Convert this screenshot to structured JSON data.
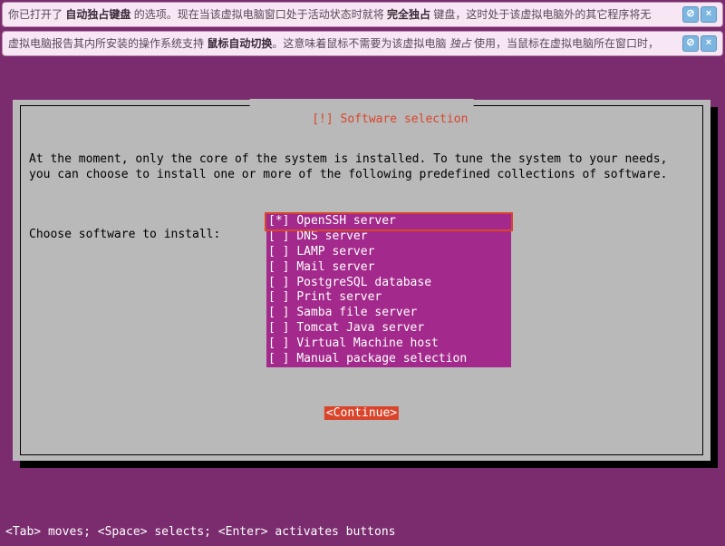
{
  "notifs": [
    {
      "prefix": "你已打开了 ",
      "bold1": "自动独占键盘",
      "mid": " 的选项。现在当该虚拟电脑窗口处于活动状态时就将 ",
      "bold2": "完全独占",
      "suffix": " 键盘，这时处于该虚拟电脑外的其它程序将无"
    },
    {
      "prefix": "虚拟电脑报告其内所安装的操作系统支持 ",
      "bold1": "鼠标自动切换",
      "mid": "。这意味着鼠标不需要为该虚拟电脑 ",
      "italic": "独占",
      "suffix": " 使用，当鼠标在虚拟电脑所在窗口时，"
    }
  ],
  "panel": {
    "title": "[!] Software selection",
    "desc": "At the moment, only the core of the system is installed. To tune the system to your needs, you can choose to install one or more of the following predefined collections of software.",
    "prompt": "Choose software to install:",
    "items": [
      {
        "mark": "[*]",
        "label": "OpenSSH server",
        "selected": true
      },
      {
        "mark": "[ ]",
        "label": "DNS server"
      },
      {
        "mark": "[ ]",
        "label": "LAMP server"
      },
      {
        "mark": "[ ]",
        "label": "Mail server"
      },
      {
        "mark": "[ ]",
        "label": "PostgreSQL database"
      },
      {
        "mark": "[ ]",
        "label": "Print server"
      },
      {
        "mark": "[ ]",
        "label": "Samba file server"
      },
      {
        "mark": "[ ]",
        "label": "Tomcat Java server"
      },
      {
        "mark": "[ ]",
        "label": "Virtual Machine host"
      },
      {
        "mark": "[ ]",
        "label": "Manual package selection"
      }
    ],
    "continue": "<Continue>"
  },
  "footer": "<Tab> moves; <Space> selects; <Enter> activates buttons"
}
